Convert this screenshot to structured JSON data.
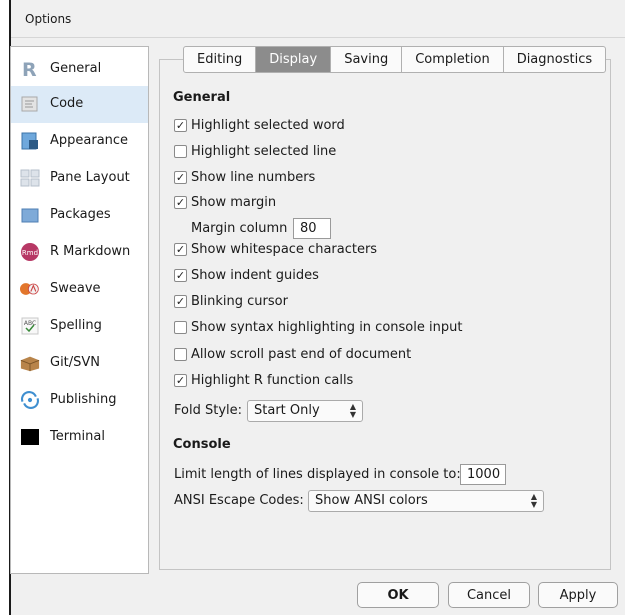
{
  "window": {
    "title": "Options"
  },
  "sidebar": {
    "items": [
      {
        "label": "General",
        "icon": "r-logo-icon"
      },
      {
        "label": "Code",
        "icon": "code-icon"
      },
      {
        "label": "Appearance",
        "icon": "appearance-icon"
      },
      {
        "label": "Pane Layout",
        "icon": "pane-layout-icon"
      },
      {
        "label": "Packages",
        "icon": "packages-icon"
      },
      {
        "label": "R Markdown",
        "icon": "rmarkdown-icon"
      },
      {
        "label": "Sweave",
        "icon": "sweave-icon"
      },
      {
        "label": "Spelling",
        "icon": "spelling-icon"
      },
      {
        "label": "Git/SVN",
        "icon": "git-svn-icon"
      },
      {
        "label": "Publishing",
        "icon": "publishing-icon"
      },
      {
        "label": "Terminal",
        "icon": "terminal-icon"
      }
    ],
    "selected": "Code"
  },
  "tabs": [
    "Editing",
    "Display",
    "Saving",
    "Completion",
    "Diagnostics"
  ],
  "active_tab": "Display",
  "general": {
    "title": "General",
    "highlight_word": "Highlight selected word",
    "highlight_line": "Highlight selected line",
    "line_numbers": "Show line numbers",
    "show_margin": "Show margin",
    "margin_column_label": "Margin column",
    "margin_column_value": "80",
    "whitespace": "Show whitespace characters",
    "indent_guides": "Show indent guides",
    "blinking_cursor": "Blinking cursor",
    "syntax_console": "Show syntax highlighting in console input",
    "scroll_past": "Allow scroll past end of document",
    "highlight_r_calls": "Highlight R function calls",
    "fold_style_label": "Fold Style:",
    "fold_style_value": "Start Only",
    "checked": {
      "highlight_word": true,
      "highlight_line": false,
      "line_numbers": true,
      "show_margin": true,
      "whitespace": true,
      "indent_guides": true,
      "blinking_cursor": true,
      "syntax_console": false,
      "scroll_past": false,
      "highlight_r_calls": true
    }
  },
  "console": {
    "title": "Console",
    "limit_label": "Limit length of lines displayed in console to:",
    "limit_value": "1000",
    "ansi_label": "ANSI Escape Codes:",
    "ansi_value": "Show ANSI colors"
  },
  "buttons": {
    "ok": "OK",
    "cancel": "Cancel",
    "apply": "Apply"
  },
  "colors": {
    "selected_bg": "#dceaf7",
    "active_tab_bg": "#8c8c8c",
    "dialog_bg": "#f0f0f0"
  }
}
